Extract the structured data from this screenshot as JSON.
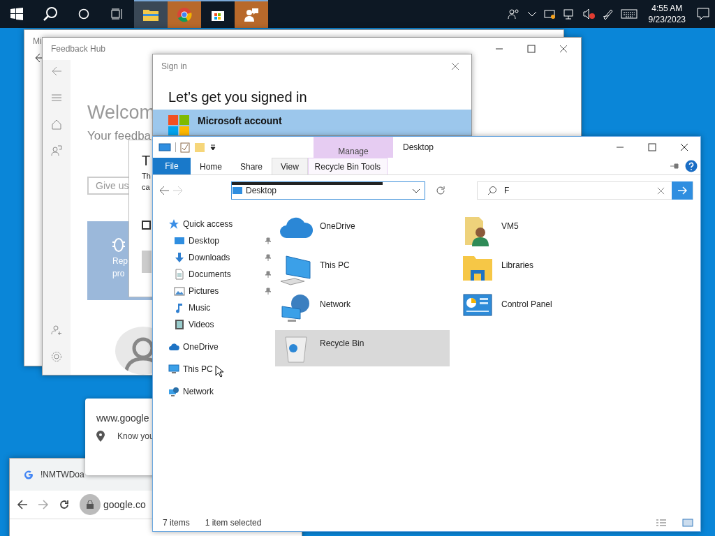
{
  "taskbar": {
    "pinned": [
      {
        "kind": "folder",
        "active": true,
        "flashing": false,
        "running": true
      },
      {
        "kind": "browser",
        "active": false,
        "flashing": true,
        "running": true
      },
      {
        "kind": "store",
        "active": false,
        "flashing": false,
        "running": true
      },
      {
        "kind": "feedback",
        "active": false,
        "flashing": true,
        "running": true
      }
    ],
    "clock": {
      "time": "4:55 AM",
      "date": "9/23/2023"
    }
  },
  "back_window": {
    "title": "Mi"
  },
  "feedback_hub": {
    "title": "Feedback Hub",
    "heading": "Welcom",
    "subheading": "Your feedba",
    "search": {
      "placeholder": "Give us"
    },
    "tile": {
      "line_1": "Rep",
      "line_2": "pro"
    },
    "dialog": {
      "title": "T",
      "line_1": "Th",
      "line_2": "ca",
      "checkbox": {
        "checked": false
      }
    }
  },
  "sign_in": {
    "title": "Sign in",
    "heading": "Let’s get you signed in",
    "account": {
      "label": "Microsoft account",
      "selected": true
    }
  },
  "chrome_popup": {
    "site": "www.google",
    "permission": "Know you"
  },
  "chrome": {
    "tab": "!NMTWDoa",
    "address": "google.co"
  },
  "explorer": {
    "context_tab": "Manage",
    "title": "Desktop",
    "tabs": [
      {
        "label": "File",
        "kind": "file",
        "selected": false
      },
      {
        "label": "Home",
        "kind": "tab",
        "selected": false
      },
      {
        "label": "Share",
        "kind": "tab",
        "selected": false
      },
      {
        "label": "View",
        "kind": "tab",
        "selected": true
      },
      {
        "label": "Recycle Bin Tools",
        "kind": "context",
        "selected": false
      }
    ],
    "address": "Desktop",
    "search": {
      "value": "F"
    },
    "nav": [
      {
        "label": "Quick access",
        "kind": "star",
        "children": [
          {
            "label": "Desktop",
            "kind": "desktop",
            "pinned": true
          },
          {
            "label": "Downloads",
            "kind": "download",
            "pinned": true
          },
          {
            "label": "Documents",
            "kind": "document",
            "pinned": true
          },
          {
            "label": "Pictures",
            "kind": "picture",
            "pinned": true
          },
          {
            "label": "Music",
            "kind": "music",
            "pinned": false
          },
          {
            "label": "Videos",
            "kind": "video",
            "pinned": false
          }
        ]
      },
      {
        "label": "OneDrive",
        "kind": "cloud"
      },
      {
        "label": "This PC",
        "kind": "pc"
      },
      {
        "label": "Network",
        "kind": "network"
      }
    ],
    "items": [
      {
        "label": "OneDrive",
        "kind": "cloud",
        "selected": false
      },
      {
        "label": "VM5",
        "kind": "user",
        "selected": false
      },
      {
        "label": "This PC",
        "kind": "pc",
        "selected": false
      },
      {
        "label": "Libraries",
        "kind": "library",
        "selected": false
      },
      {
        "label": "Network",
        "kind": "network",
        "selected": false
      },
      {
        "label": "Control Panel",
        "kind": "control",
        "selected": false
      },
      {
        "label": "Recycle Bin",
        "kind": "bin",
        "selected": true
      }
    ],
    "status": {
      "count": "7 items",
      "selection": "1 item selected"
    }
  }
}
